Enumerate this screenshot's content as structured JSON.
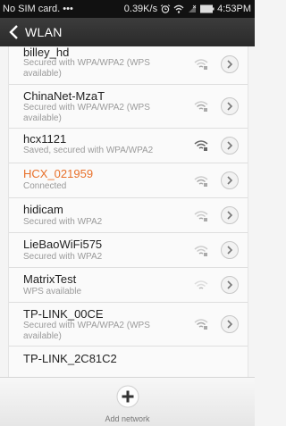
{
  "statusbar": {
    "carrier": "No SIM card. •••",
    "speed": "0.39K/s",
    "time": "4:53PM",
    "icons": [
      "alarm-icon",
      "wifi-icon",
      "signal-icon",
      "battery-icon"
    ]
  },
  "header": {
    "title": "WLAN",
    "back_icon": "back-arrow-icon"
  },
  "networks": [
    {
      "name": "billey_hd",
      "status": "Secured with WPA/WPA2 (WPS available)",
      "signal": "weak"
    },
    {
      "name": "ChinaNet-MzaT",
      "status": "Secured with WPA/WPA2 (WPS available)",
      "signal": "weak"
    },
    {
      "name": "hcx1121",
      "status": "Saved, secured with WPA/WPA2",
      "signal": "strong"
    },
    {
      "name": "HCX_021959",
      "status": "Connected",
      "signal": "weak",
      "connected": true
    },
    {
      "name": "hidicam",
      "status": "Secured with WPA2",
      "signal": "weak"
    },
    {
      "name": "LieBaoWiFi575",
      "status": "Secured with WPA2",
      "signal": "weak"
    },
    {
      "name": "MatrixTest",
      "status": "WPS available",
      "signal": "weak"
    },
    {
      "name": "TP-LINK_00CE",
      "status": "Secured with WPA/WPA2 (WPS available)",
      "signal": "weak"
    },
    {
      "name": "TP-LINK_2C81C2",
      "status": "",
      "signal": "weak"
    }
  ],
  "footer": {
    "add_label": "Add network",
    "add_icon": "plus-icon"
  },
  "colors": {
    "accent": "#e8702a",
    "titlebar": "#333333",
    "statusbar": "#111111"
  }
}
